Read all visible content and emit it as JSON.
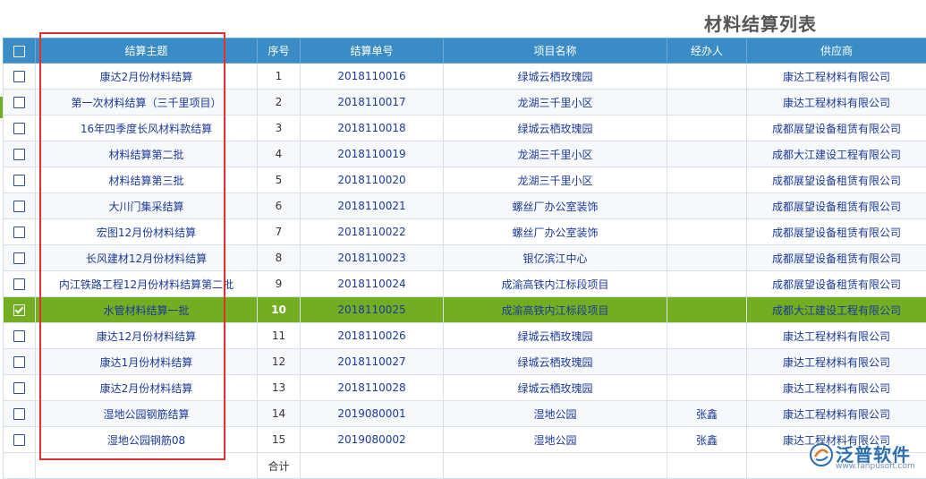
{
  "page": {
    "title": "材料结算列表"
  },
  "table": {
    "headers": {
      "subject": "结算主题",
      "seq": "序号",
      "number": "结算单号",
      "project": "项目名称",
      "handler": "经办人",
      "supplier": "供应商"
    },
    "selected_index": 9,
    "rows": [
      {
        "subject": "康达2月份材料结算",
        "seq": "1",
        "number": "2018110016",
        "project": "绿城云栖玫瑰园",
        "handler": "",
        "supplier": "康达工程材料有限公司"
      },
      {
        "subject": "第一次材料结算（三千里项目）",
        "seq": "2",
        "number": "2018110017",
        "project": "龙湖三千里小区",
        "handler": "",
        "supplier": "康达工程材料有限公司"
      },
      {
        "subject": "16年四季度长风材料款结算",
        "seq": "3",
        "number": "2018110018",
        "project": "绿城云栖玫瑰园",
        "handler": "",
        "supplier": "成都展望设备租赁有限公司"
      },
      {
        "subject": "材料结算第二批",
        "seq": "4",
        "number": "2018110019",
        "project": "龙湖三千里小区",
        "handler": "",
        "supplier": "成都大江建设工程有限公司"
      },
      {
        "subject": "材料结算第三批",
        "seq": "5",
        "number": "2018110020",
        "project": "龙湖三千里小区",
        "handler": "",
        "supplier": "成都展望设备租赁有限公司"
      },
      {
        "subject": "大川门集采结算",
        "seq": "6",
        "number": "2018110021",
        "project": "螺丝厂办公室装饰",
        "handler": "",
        "supplier": "成都展望设备租赁有限公司"
      },
      {
        "subject": "宏图12月份材料结算",
        "seq": "7",
        "number": "2018110022",
        "project": "螺丝厂办公室装饰",
        "handler": "",
        "supplier": "成都展望设备租赁有限公司"
      },
      {
        "subject": "长风建材12月份材料结算",
        "seq": "8",
        "number": "2018110023",
        "project": "银亿滨江中心",
        "handler": "",
        "supplier": "成都展望设备租赁有限公司"
      },
      {
        "subject": "内江铁路工程12月份材料结算第二批",
        "seq": "9",
        "number": "2018110024",
        "project": "成渝高铁内江标段项目",
        "handler": "",
        "supplier": "成都展望设备租赁有限公司"
      },
      {
        "subject": "水管材料结算一批",
        "seq": "10",
        "number": "2018110025",
        "project": "成渝高铁内江标段项目",
        "handler": "",
        "supplier": "成都大江建设工程有限公司"
      },
      {
        "subject": "康达12月份材料结算",
        "seq": "11",
        "number": "2018110026",
        "project": "绿城云栖玫瑰园",
        "handler": "",
        "supplier": "康达工程材料有限公司"
      },
      {
        "subject": "康达1月份材料结算",
        "seq": "12",
        "number": "2018110027",
        "project": "绿城云栖玫瑰园",
        "handler": "",
        "supplier": "康达工程材料有限公司"
      },
      {
        "subject": "康达2月份材料结算",
        "seq": "13",
        "number": "2018110028",
        "project": "绿城云栖玫瑰园",
        "handler": "",
        "supplier": "康达工程材料有限公司"
      },
      {
        "subject": "湿地公园钢筋结算",
        "seq": "14",
        "number": "2019080001",
        "project": "湿地公园",
        "handler": "张鑫",
        "supplier": "康达工程材料有限公司"
      },
      {
        "subject": "湿地公园钢筋08",
        "seq": "15",
        "number": "2019080002",
        "project": "湿地公园",
        "handler": "张鑫",
        "supplier": "康达工程材料有限公司"
      }
    ],
    "total_label": "合计"
  },
  "watermark": {
    "name": "泛普软件",
    "url": "www.fanpusoft.com"
  }
}
